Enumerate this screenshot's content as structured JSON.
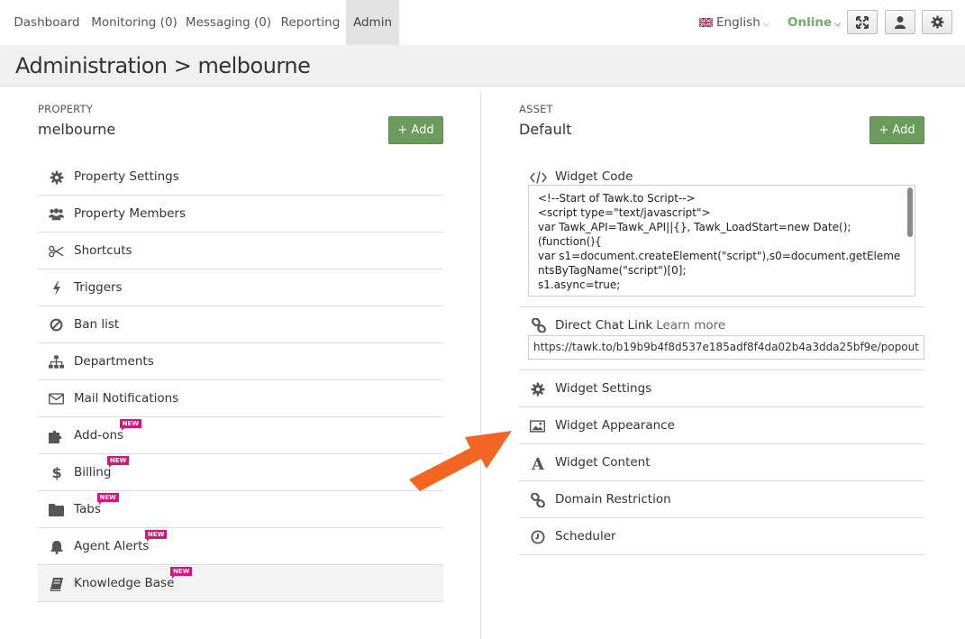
{
  "nav": {
    "items": [
      {
        "label": "Dashboard"
      },
      {
        "label": "Monitoring (0)"
      },
      {
        "label": "Messaging (0)"
      },
      {
        "label": "Reporting"
      },
      {
        "label": "Admin"
      }
    ],
    "language": "English",
    "status": "Online"
  },
  "header": {
    "title": "Administration > melbourne"
  },
  "property": {
    "section_label": "PROPERTY",
    "name": "melbourne",
    "add_label": "+ Add",
    "new_tag": "NEW",
    "items": [
      {
        "label": "Property Settings",
        "icon": "gear-icon"
      },
      {
        "label": "Property Members",
        "icon": "users-icon"
      },
      {
        "label": "Shortcuts",
        "icon": "scissors-icon"
      },
      {
        "label": "Triggers",
        "icon": "bolt-icon"
      },
      {
        "label": "Ban list",
        "icon": "ban-icon"
      },
      {
        "label": "Departments",
        "icon": "sitemap-icon"
      },
      {
        "label": "Mail Notifications",
        "icon": "envelope-icon"
      },
      {
        "label": "Add-ons",
        "icon": "puzzle-icon",
        "new": true
      },
      {
        "label": "Billing",
        "icon": "dollar-icon",
        "new": true
      },
      {
        "label": "Tabs",
        "icon": "folder-icon",
        "new": true
      },
      {
        "label": "Agent Alerts",
        "icon": "bell-icon",
        "new": true
      },
      {
        "label": "Knowledge Base",
        "icon": "book-icon",
        "new": true
      }
    ]
  },
  "asset": {
    "section_label": "ASSET",
    "name": "Default",
    "add_label": "+ Add",
    "widget_code": {
      "label": "Widget Code",
      "code": "<!--Start of Tawk.to Script-->\n<script type=\"text/javascript\">\nvar Tawk_API=Tawk_API||{}, Tawk_LoadStart=new Date();\n(function(){\nvar s1=document.createElement(\"script\"),s0=document.getElementsByTagName(\"script\")[0];\ns1.async=true;"
    },
    "direct_chat": {
      "label": "Direct Chat Link",
      "learn_more": "Learn more",
      "url": "https://tawk.to/b19b9b4f8d537e185adf8f4da02b4a3dda25bf9e/popout"
    },
    "items": [
      {
        "label": "Widget Settings",
        "icon": "gear-icon"
      },
      {
        "label": "Widget Appearance",
        "icon": "image-icon"
      },
      {
        "label": "Widget Content",
        "icon": "font-icon"
      },
      {
        "label": "Domain Restriction",
        "icon": "link-icon"
      },
      {
        "label": "Scheduler",
        "icon": "clock-icon"
      }
    ]
  },
  "colors": {
    "accent_green": "#6c9c5c",
    "online_green": "#78a867",
    "new_badge": "#d6157a",
    "arrow_orange": "#f26522"
  }
}
